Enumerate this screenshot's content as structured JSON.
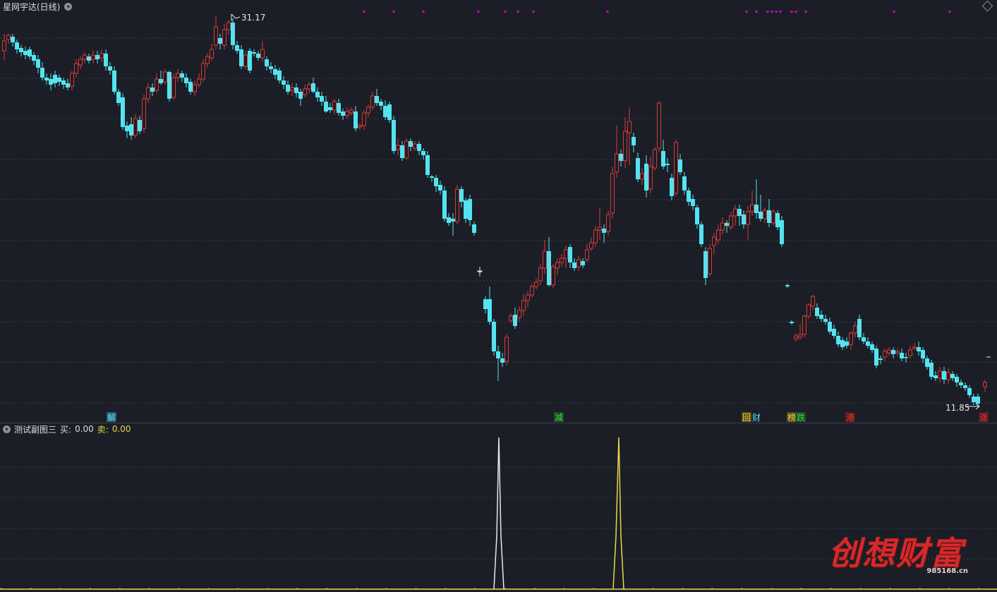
{
  "header": {
    "title": "星网宇达(日线)",
    "dropdown_icon": "chevron-down-icon",
    "settings_icon": "diamond-icon"
  },
  "main_chart": {
    "high_label": "31.17",
    "low_label": "11.85",
    "colors": {
      "up": "#d83a3a",
      "down": "#54e3f0",
      "grid": "#3a3f4a",
      "magenta": "#d000d0"
    },
    "signals": [
      {
        "text": "解",
        "color": "#54e3f0",
        "bg": "#2a5a6a"
      },
      {
        "text": "减",
        "color": "#3fd04a",
        "bg": "#1e4a24"
      },
      {
        "text": "回",
        "color": "#e8d84a",
        "bg": "#5a4a1a"
      },
      {
        "text": "财",
        "color": "#54e3f0",
        "bg": "#1b1e26"
      },
      {
        "text": "榜",
        "color": "#e8d84a",
        "bg": "#5a4a1a"
      },
      {
        "text": "跌",
        "color": "#3fd04a",
        "bg": "#1e4a24"
      },
      {
        "text": "港",
        "color": "#d83a3a",
        "bg": "#5a1a1a"
      },
      {
        "text": "涨",
        "color": "#d83a3a",
        "bg": "#5a1a1a"
      }
    ]
  },
  "sub_chart": {
    "name": "测试副图三",
    "buy_label": "买:",
    "buy_value": "0.00",
    "sell_label": "卖:",
    "sell_value": "0.00",
    "colors": {
      "buy": "#e8e8e8",
      "sell": "#e8d84a"
    }
  },
  "watermark": {
    "text": "创想财富",
    "url": "985168.cn"
  }
}
